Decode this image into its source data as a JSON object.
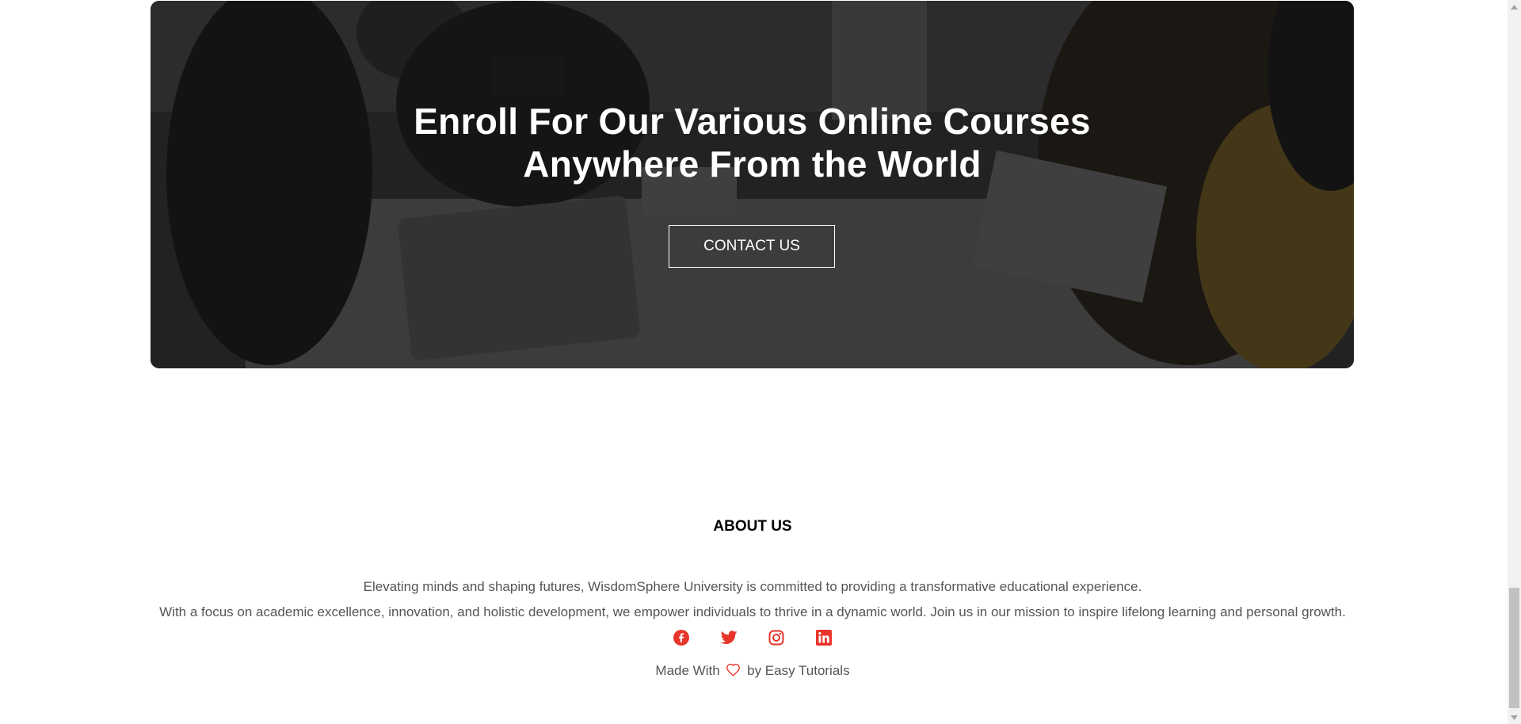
{
  "cta": {
    "title_line1": "Enroll For Our Various Online Courses",
    "title_line2": "Anywhere From the World",
    "button_label": "CONTACT US"
  },
  "footer": {
    "heading": "ABOUT US",
    "text_line1": "Elevating minds and shaping futures, WisdomSphere University is committed to providing a transformative educational experience.",
    "text_line2": "With a focus on academic excellence, innovation, and holistic development, we empower individuals to thrive in a dynamic world. Join us in our mission to inspire lifelong learning and personal growth.",
    "socials": [
      {
        "icon": "facebook-icon"
      },
      {
        "icon": "twitter-icon"
      },
      {
        "icon": "instagram-icon"
      },
      {
        "icon": "linkedin-icon"
      }
    ],
    "made_with_prefix": "Made With",
    "made_with_suffix": "by Easy Tutorials"
  },
  "colors": {
    "accent": "#e8352b",
    "text": "#555555",
    "heading": "#000000"
  }
}
